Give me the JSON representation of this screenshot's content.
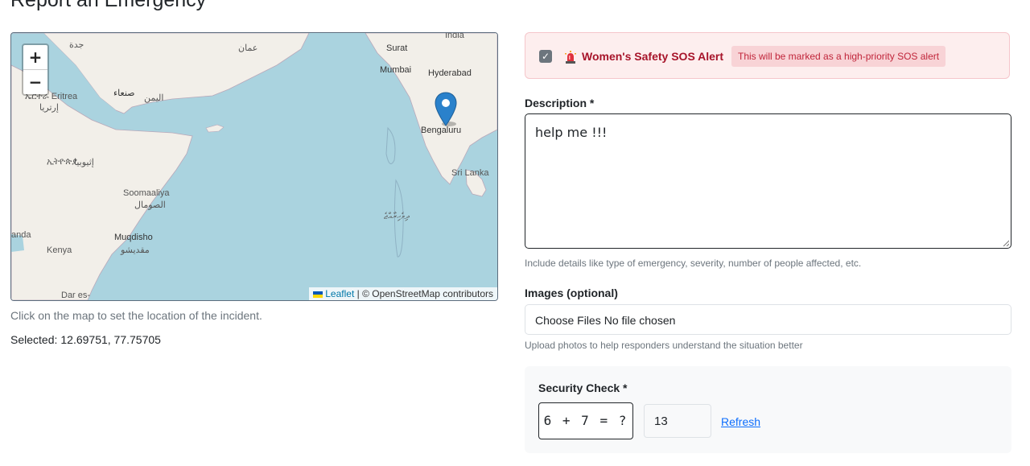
{
  "page": {
    "title": "Report an Emergency"
  },
  "map": {
    "zoom_in": "+",
    "zoom_out": "−",
    "labels": {
      "india": "India",
      "oman": "عمان",
      "surat": "Surat",
      "mumbai": "Mumbai",
      "hyderabad": "Hyderabad",
      "jeddah": "جدة",
      "sanaa": "صنعاء",
      "yemen": "اليمن",
      "eritrea": "ኤርትራ Eritrea",
      "eritrea_ar": "إرتريا",
      "bengaluru": "Bengaluru",
      "sri_lanka": "Sri Lanka",
      "ethiopia": "ኢትዮጵያ",
      "ethiopia_ar": "إثيوبيا",
      "somalia": "Soomaaliya",
      "somalia_ar": "الصومال",
      "maldives": "ދިވެހިރާއްޖެ",
      "uganda": "anda",
      "mogadishu": "Muqdisho",
      "mogadishu_ar": "مقديشو",
      "kenya": "Kenya",
      "dar": "Dar es-"
    },
    "attribution_link": "Leaflet",
    "attribution_text": " | © OpenStreetMap contributors",
    "help_text": "Click on the map to set the location of the incident.",
    "selected_label": "Selected:",
    "selected_value": "12.69751, 77.75705",
    "colors": {
      "water": "#aad3df",
      "land": "#f2efe9",
      "marker": "#2a81cb"
    }
  },
  "sos": {
    "checked": true,
    "checkbox_mark": "✓",
    "icon": "siren-icon",
    "label": "Women's Safety SOS Alert",
    "badge": "This will be marked as a high-priority SOS alert",
    "colors": {
      "background": "#fdeeee",
      "label": "#a7142a",
      "badge_bg": "#f8d3d6"
    }
  },
  "description": {
    "label": "Description *",
    "value": "help me !!!",
    "help": "Include details like type of emergency, severity, number of people affected, etc."
  },
  "images": {
    "label": "Images (optional)",
    "button": "Choose Files",
    "status": "No file chosen",
    "help": "Upload photos to help responders understand the situation better"
  },
  "security": {
    "label": "Security Check *",
    "challenge": "6 + 7 = ?",
    "answer": "13",
    "refresh": "Refresh"
  }
}
